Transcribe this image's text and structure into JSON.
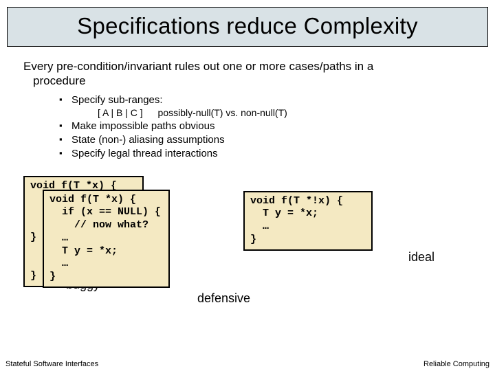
{
  "title": "Specifications reduce Complexity",
  "lead": {
    "line1": "Every pre-condition/invariant rules out one or more cases/paths in a",
    "line2": "procedure"
  },
  "bullets": {
    "b1": "Specify sub-ranges:",
    "sub_a": "[ A | B | C ]",
    "sub_b": "possibly-null(T) vs. non-null(T)",
    "b2": "Make impossible paths obvious",
    "b3": "State (non-) aliasing assumptions",
    "b4": "Specify legal thread interactions"
  },
  "code": {
    "buggy": "void f(T *x) {\n  if (x == NULL)\n    T y = *x;\n    // now what?\n} …\n  T y = *x;\n  …\n}",
    "defensive": "void f(T *x) {\n  if (x == NULL) {\n    // now what?\n  …\n  T y = *x;\n  …\n}",
    "ideal": "void f(T *!x) {\n  T y = *x;\n  …\n}"
  },
  "labels": {
    "buggy": "buggy",
    "defensive": "defensive",
    "ideal": "ideal"
  },
  "footer": {
    "left": "Stateful Software Interfaces",
    "right": "Reliable Computing"
  }
}
